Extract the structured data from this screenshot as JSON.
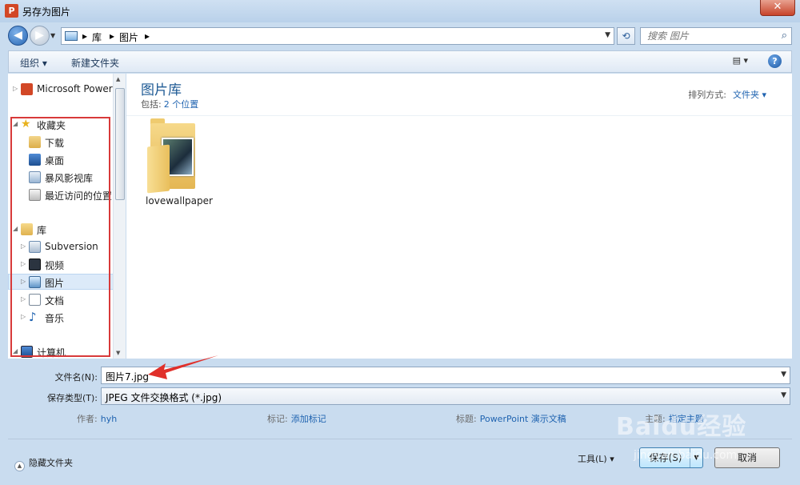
{
  "window": {
    "title": "另存为图片",
    "app_icon": "P",
    "close_glyph": "✕"
  },
  "address": {
    "segments": [
      "库",
      "图片"
    ],
    "search_placeholder": "搜索 图片"
  },
  "toolbar": {
    "organize": "组织 ▾",
    "new_folder": "新建文件夹",
    "help": "?"
  },
  "nav": {
    "items": [
      {
        "label": "Microsoft PowerPoint",
        "icon": "powerpoint-icon"
      },
      {
        "label": "收藏夹",
        "icon": "star-icon"
      },
      {
        "label": "下载",
        "icon": "download-folder-icon"
      },
      {
        "label": "桌面",
        "icon": "desktop-icon"
      },
      {
        "label": "暴风影视库",
        "icon": "video-library-icon"
      },
      {
        "label": "最近访问的位置",
        "icon": "recent-places-icon"
      },
      {
        "label": "库",
        "icon": "library-icon"
      },
      {
        "label": "Subversion",
        "icon": "subversion-icon"
      },
      {
        "label": "视频",
        "icon": "video-icon"
      },
      {
        "label": "图片",
        "icon": "pictures-icon"
      },
      {
        "label": "文档",
        "icon": "documents-icon"
      },
      {
        "label": "音乐",
        "icon": "music-icon"
      },
      {
        "label": "计算机",
        "icon": "computer-icon"
      }
    ]
  },
  "main": {
    "title": "图片库",
    "includes_label": "包括:",
    "includes_link": "2 个位置",
    "arrange_label": "排列方式:",
    "arrange_value": "文件夹 ▾",
    "folders": [
      {
        "name": "lovewallpaper"
      }
    ]
  },
  "form": {
    "filename_label": "文件名(N):",
    "filename_value": "图片7.jpg",
    "filetype_label": "保存类型(T):",
    "filetype_value": "JPEG 文件交换格式 (*.jpg)",
    "author_label": "作者:",
    "author_value": "hyh",
    "tags_label": "标记:",
    "tags_value": "添加标记",
    "subject_label": "标题:",
    "subject_value": "PowerPoint 演示文稿",
    "topic_label": "主题:",
    "topic_value": "指定主题"
  },
  "footer": {
    "hide_folders": "隐藏文件夹",
    "tools": "工具(L)",
    "save": "保存(S)",
    "cancel": "取消"
  },
  "watermark": {
    "brand": "Baidu经验",
    "url": "jingyan.baidu.com"
  },
  "colors": {
    "highlight_box": "#d83a3a",
    "link": "#1f63b0",
    "library_title": "#1e5a94"
  }
}
